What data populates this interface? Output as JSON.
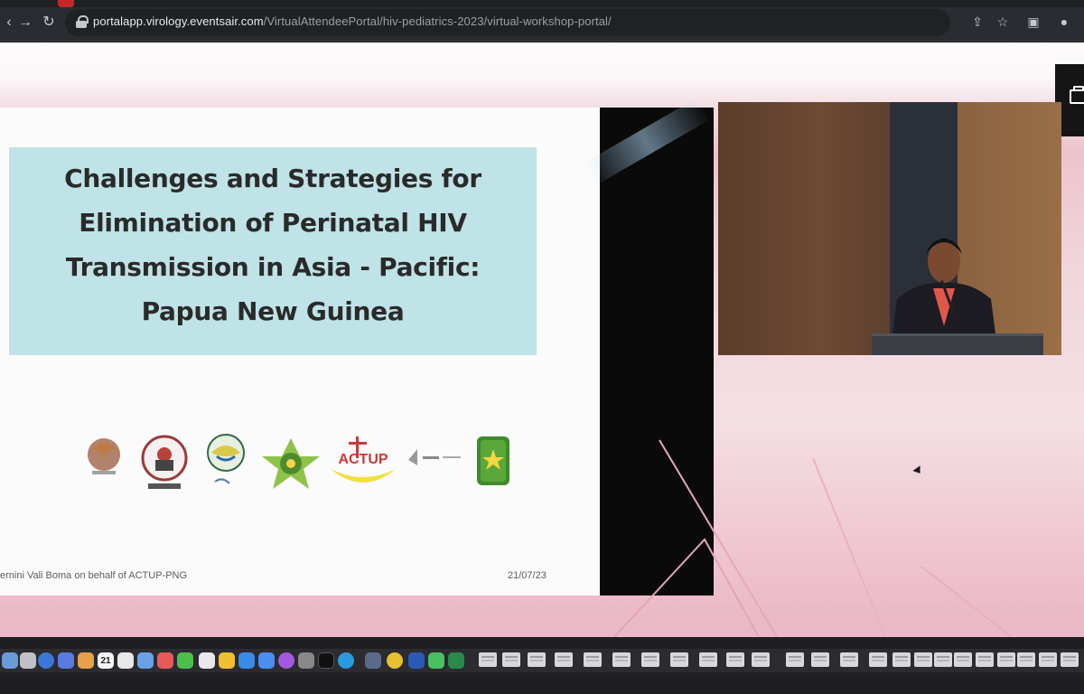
{
  "browser": {
    "url_domain": "portalapp.virology.eventsair.com",
    "url_path": "/VirtualAttendeePortal/hiv-pediatrics-2023/virtual-workshop-portal/",
    "back_icon": "arrow-left-icon",
    "forward_icon": "arrow-right-icon",
    "reload_icon": "reload-icon",
    "toolbar_icons": [
      "share-icon",
      "star-icon",
      "extension-icon"
    ]
  },
  "slide": {
    "title_lines": [
      "Challenges and Strategies for",
      "Elimination of Perinatal HIV",
      "Transmission in Asia - Pacific:",
      "Papua New Guinea"
    ],
    "logo_actup_text": "ACTUP",
    "footer_left": "ernini Vali Boma on behalf of ACTUP-PNG",
    "footer_right": "21/07/23"
  },
  "dock": {
    "calendar_day": "21"
  },
  "colors": {
    "title_box": "#bfe3e6",
    "page_pink": "#ecc3ce",
    "chrome": "#2a2c31"
  }
}
